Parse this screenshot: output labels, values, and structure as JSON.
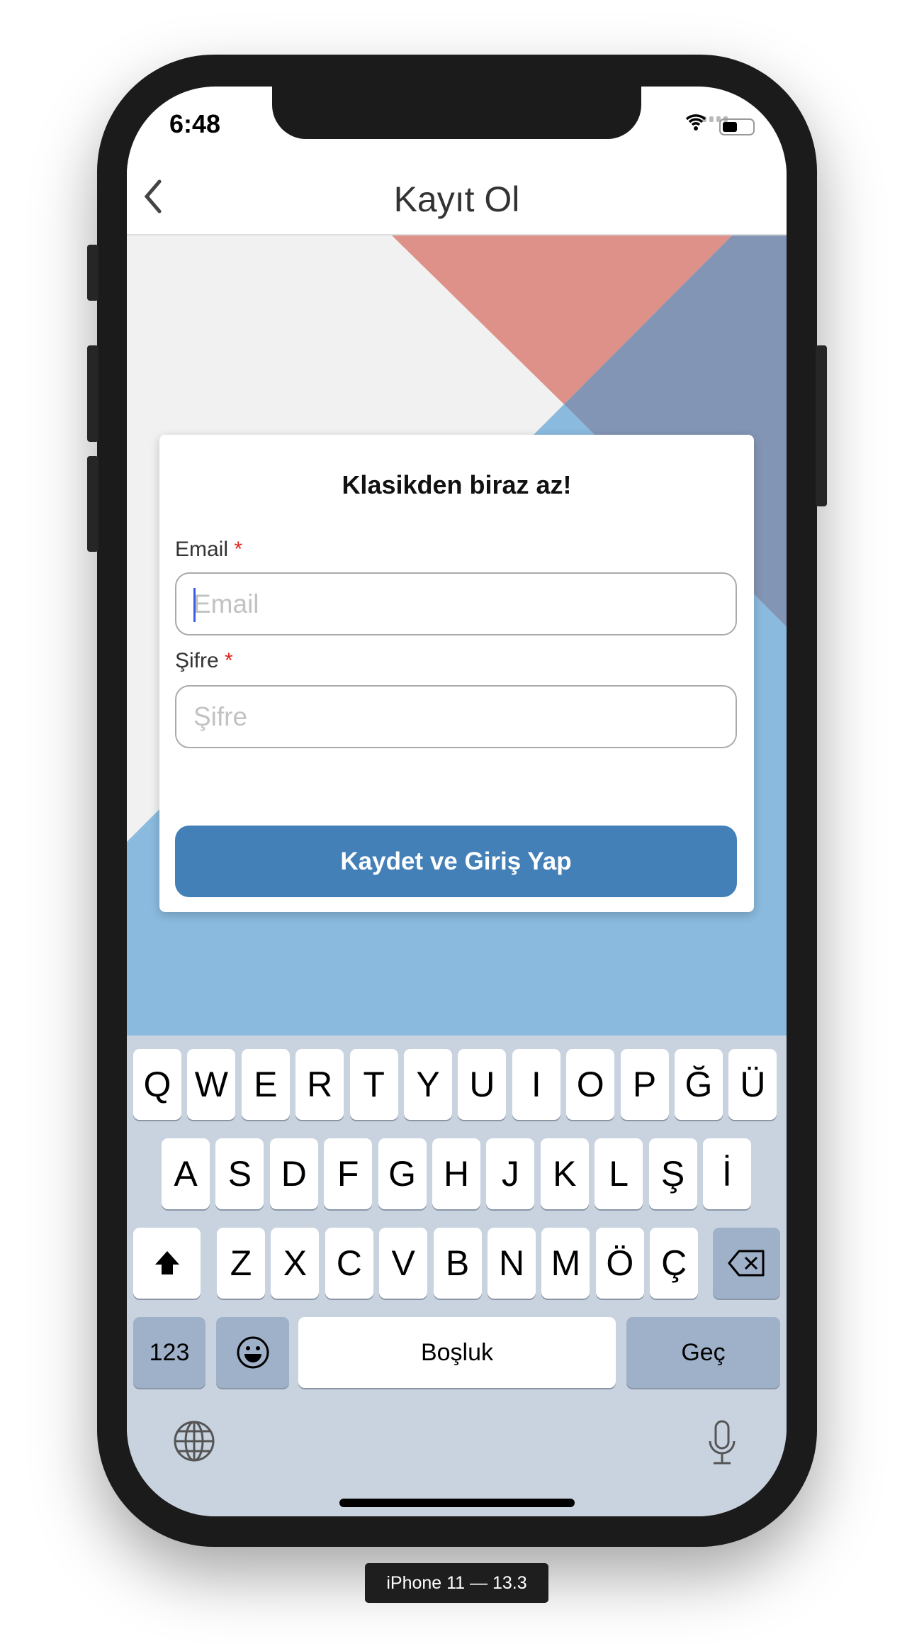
{
  "status": {
    "time": "6:48"
  },
  "nav": {
    "title": "Kayıt Ol",
    "back_icon": "chevron-left-icon"
  },
  "form": {
    "heading": "Klasikden biraz az!",
    "email_label": "Email",
    "email_placeholder": "Email",
    "email_value": "",
    "password_label": "Şifre",
    "password_placeholder": "Şifre",
    "password_value": "",
    "required_mark": "*",
    "submit_label": "Kaydet ve Giriş Yap"
  },
  "colors": {
    "background": "#f1f1f1",
    "pink": "#de9189",
    "slate": "#8395b5",
    "light_blue": "#8abade",
    "button": "#4480b8",
    "keyboard": "#c8d3df"
  },
  "keyboard": {
    "row1": [
      "Q",
      "W",
      "E",
      "R",
      "T",
      "Y",
      "U",
      "I",
      "O",
      "P",
      "Ğ",
      "Ü"
    ],
    "row2": [
      "A",
      "S",
      "D",
      "F",
      "G",
      "H",
      "J",
      "K",
      "L",
      "Ş",
      "İ"
    ],
    "row3": [
      "Z",
      "X",
      "C",
      "V",
      "B",
      "N",
      "M",
      "Ö",
      "Ç"
    ],
    "numbers": "123",
    "space": "Boşluk",
    "return": "Geç"
  },
  "device_label": "iPhone 11 — 13.3"
}
